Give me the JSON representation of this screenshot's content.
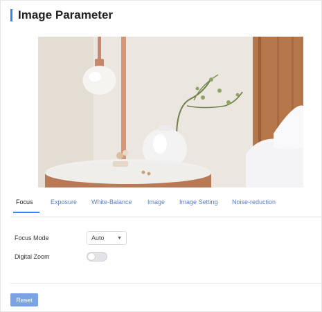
{
  "header": {
    "title": "Image Parameter"
  },
  "tabs": [
    {
      "label": "Focus",
      "active": true
    },
    {
      "label": "Exposure",
      "active": false
    },
    {
      "label": "White-Balance",
      "active": false
    },
    {
      "label": "Image",
      "active": false
    },
    {
      "label": "Image Setting",
      "active": false
    },
    {
      "label": "Noise-reduction",
      "active": false
    }
  ],
  "focus": {
    "focus_mode_label": "Focus Mode",
    "focus_mode_value": "Auto",
    "digital_zoom_label": "Digital Zoom",
    "digital_zoom_on": false
  },
  "footer": {
    "reset_label": "Reset"
  },
  "colors": {
    "accent": "#3b82f6",
    "tab_text": "#5a7dbd",
    "reset_button": "#7aa3e6"
  }
}
